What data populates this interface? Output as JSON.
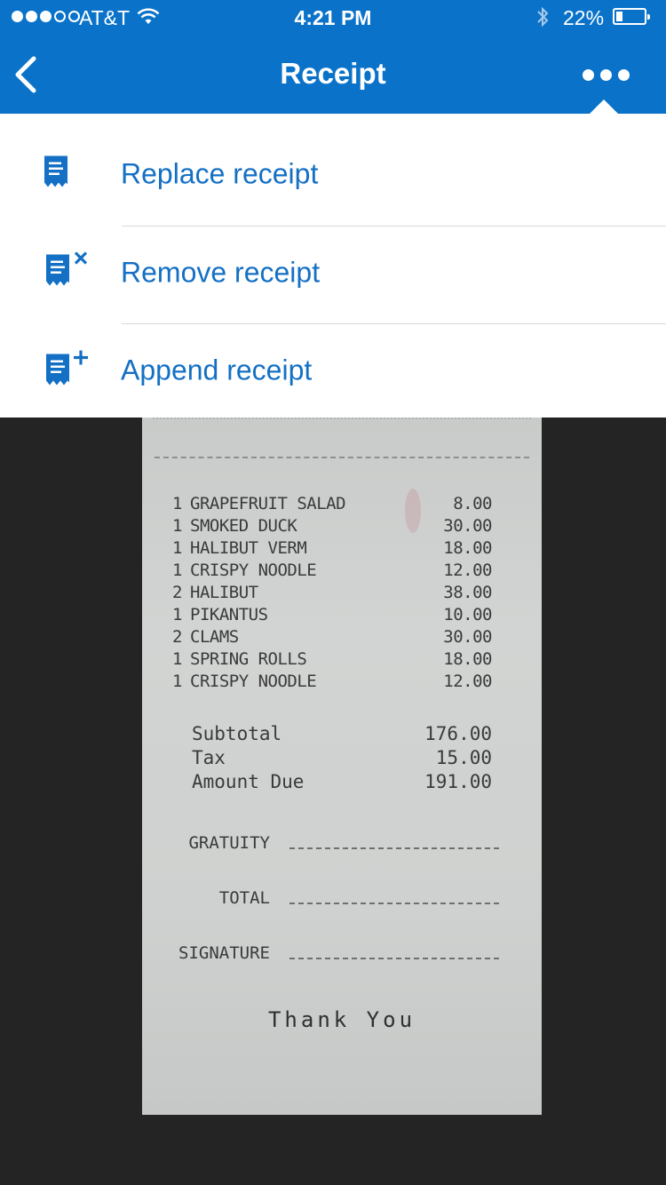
{
  "status_bar": {
    "carrier": "AT&T",
    "time": "4:21 PM",
    "battery_percent": "22%",
    "battery_level": 0.22,
    "signal_bars_filled": 3,
    "signal_bars_total": 5
  },
  "nav": {
    "title": "Receipt",
    "back_icon": "chevron-left-icon",
    "more_icon": "more-dots-icon"
  },
  "menu": {
    "items": [
      {
        "label": "Replace receipt",
        "icon": "receipt-icon"
      },
      {
        "label": "Remove receipt",
        "icon": "receipt-remove-icon"
      },
      {
        "label": "Append receipt",
        "icon": "receipt-add-icon"
      }
    ]
  },
  "receipt": {
    "items": [
      {
        "qty": "1",
        "name": "GRAPEFRUIT SALAD",
        "price": "8.00"
      },
      {
        "qty": "1",
        "name": "SMOKED DUCK",
        "price": "30.00"
      },
      {
        "qty": "1",
        "name": "HALIBUT VERM",
        "price": "18.00"
      },
      {
        "qty": "1",
        "name": "CRISPY NOODLE",
        "price": "12.00"
      },
      {
        "qty": "2",
        "name": "HALIBUT",
        "price": "38.00"
      },
      {
        "qty": "1",
        "name": "PIKANTUS",
        "price": "10.00"
      },
      {
        "qty": "2",
        "name": "CLAMS",
        "price": "30.00"
      },
      {
        "qty": "1",
        "name": "SPRING ROLLS",
        "price": "18.00"
      },
      {
        "qty": "1",
        "name": "CRISPY NOODLE",
        "price": "12.00"
      }
    ],
    "subtotal_label": "Subtotal",
    "subtotal": "176.00",
    "tax_label": "Tax",
    "tax": "15.00",
    "amount_due_label": "Amount Due",
    "amount_due": "191.00",
    "gratuity_label": "GRATUITY",
    "total_label": "TOTAL",
    "signature_label": "SIGNATURE",
    "thank_you": "Thank You"
  },
  "colors": {
    "nav_bar": "#0a73c9",
    "menu_text": "#1470c4",
    "background": "#242424"
  }
}
